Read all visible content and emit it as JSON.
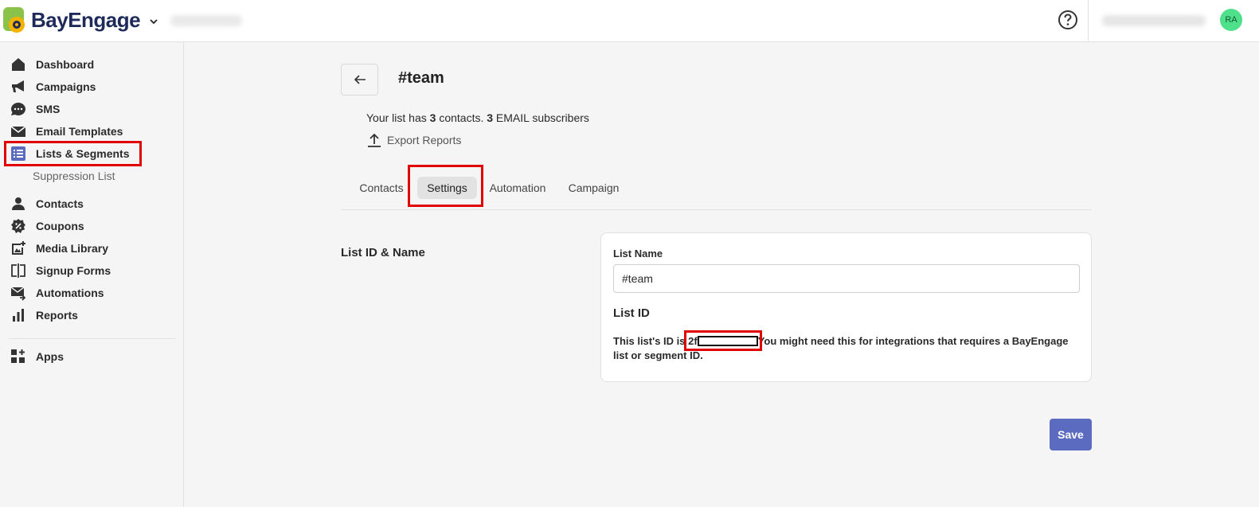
{
  "header": {
    "brand": "BayEngage",
    "avatar_initials": "RA"
  },
  "sidebar": {
    "items": [
      {
        "label": "Dashboard",
        "icon": "home-icon"
      },
      {
        "label": "Campaigns",
        "icon": "megaphone-icon"
      },
      {
        "label": "SMS",
        "icon": "chat-icon"
      },
      {
        "label": "Email Templates",
        "icon": "envelope-icon"
      },
      {
        "label": "Lists & Segments",
        "icon": "list-icon",
        "active": true
      },
      {
        "label": "Suppression List",
        "sub": true
      },
      {
        "label": "Contacts",
        "icon": "person-icon"
      },
      {
        "label": "Coupons",
        "icon": "coupon-icon"
      },
      {
        "label": "Media Library",
        "icon": "image-add-icon"
      },
      {
        "label": "Signup Forms",
        "icon": "form-icon"
      },
      {
        "label": "Automations",
        "icon": "automation-icon"
      },
      {
        "label": "Reports",
        "icon": "bar-chart-icon"
      },
      {
        "label": "Apps",
        "icon": "apps-icon"
      }
    ]
  },
  "list": {
    "title": "#team",
    "summary_prefix": "Your list has ",
    "contacts_count": "3",
    "summary_mid": " contacts. ",
    "subscribers_count": "3",
    "summary_suffix": " EMAIL subscribers",
    "export_label": "Export Reports"
  },
  "tabs": [
    "Contacts",
    "Settings",
    "Automation",
    "Campaign"
  ],
  "active_tab": "Settings",
  "settings": {
    "section_title": "List ID & Name",
    "list_name_label": "List Name",
    "list_name_value": "#team",
    "list_id_heading": "List ID",
    "list_id_text_prefix": "This list's ID is ",
    "list_id_visible": "2f",
    "list_id_text_suffix": "You might need this for integrations that requires a BayEngage list or segment ID."
  },
  "actions": {
    "save_label": "Save"
  },
  "colors": {
    "brand_navy": "#1e2a5a",
    "primary": "#5b6bc0",
    "highlight": "#e00000",
    "avatar": "#4ee08b"
  }
}
